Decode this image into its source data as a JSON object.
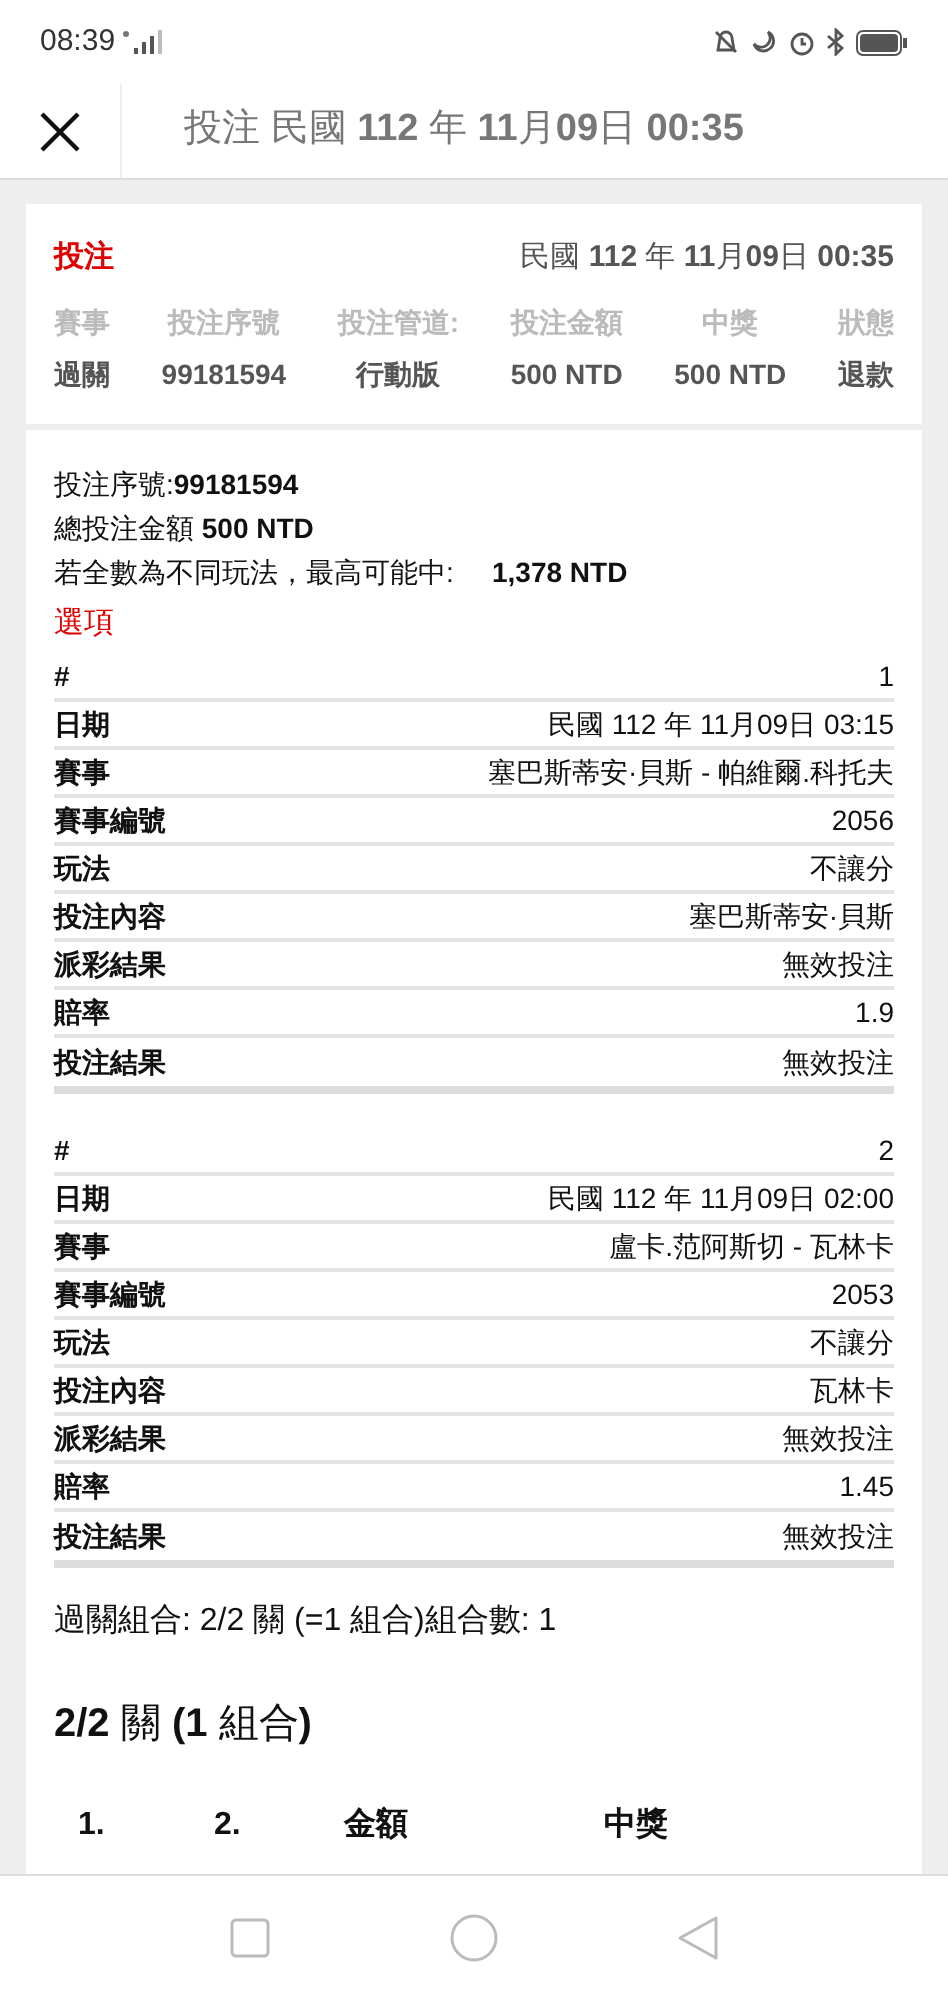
{
  "status_bar": {
    "time": "08:39"
  },
  "header": {
    "title": "投注 民國 **112** 年 **11**月**09**日 **00:35**"
  },
  "summary": {
    "type": "投注",
    "date": "民國 **112** 年 **11**月**09**日 **00:35**",
    "columns": [
      {
        "label": "賽事",
        "value": "過關"
      },
      {
        "label": "投注序號",
        "value": "99181594"
      },
      {
        "label": "投注管道:",
        "value": "行動版"
      },
      {
        "label": "投注金額",
        "value": "500 NTD"
      },
      {
        "label": "中獎",
        "value": "500 NTD"
      },
      {
        "label": "狀態",
        "value": "退款"
      }
    ]
  },
  "details": {
    "lines": [
      "投注序號:**99181594**",
      "總投注金額 **500 NTD**"
    ],
    "max_win_label": "若全數為不同玩法，最高可能中:",
    "max_win_value": "1,378 NTD",
    "options_title": "選項",
    "selections": [
      {
        "rows": [
          {
            "label": "#",
            "value": "1"
          },
          {
            "label": "日期",
            "value": "民國 112 年 11月09日 03:15"
          },
          {
            "label": "賽事",
            "value": "塞巴斯蒂安·貝斯 - 帕維爾.科托夫"
          },
          {
            "label": "賽事編號",
            "value": "2056"
          },
          {
            "label": "玩法",
            "value": "不讓分"
          },
          {
            "label": "投注內容",
            "value": "塞巴斯蒂安·貝斯"
          },
          {
            "label": "派彩結果",
            "value": "無效投注"
          },
          {
            "label": "賠率",
            "value": "1.9"
          },
          {
            "label": "投注結果",
            "value": "無效投注"
          }
        ]
      },
      {
        "rows": [
          {
            "label": "#",
            "value": "2"
          },
          {
            "label": "日期",
            "value": "民國 112 年 11月09日 02:00"
          },
          {
            "label": "賽事",
            "value": "盧卡.范阿斯切 - 瓦林卡"
          },
          {
            "label": "賽事編號",
            "value": "2053"
          },
          {
            "label": "玩法",
            "value": "不讓分"
          },
          {
            "label": "投注內容",
            "value": "瓦林卡"
          },
          {
            "label": "派彩結果",
            "value": "無效投注"
          },
          {
            "label": "賠率",
            "value": "1.45"
          },
          {
            "label": "投注結果",
            "value": "無效投注"
          }
        ]
      }
    ],
    "combo_line": "過關組合: 2/2 關 (=1 組合)組合數: 1",
    "combo_heading": "**2/2** 關 **(1** 組合**)**",
    "combo_columns": [
      "1.",
      "2.",
      "金額",
      "中獎"
    ]
  }
}
